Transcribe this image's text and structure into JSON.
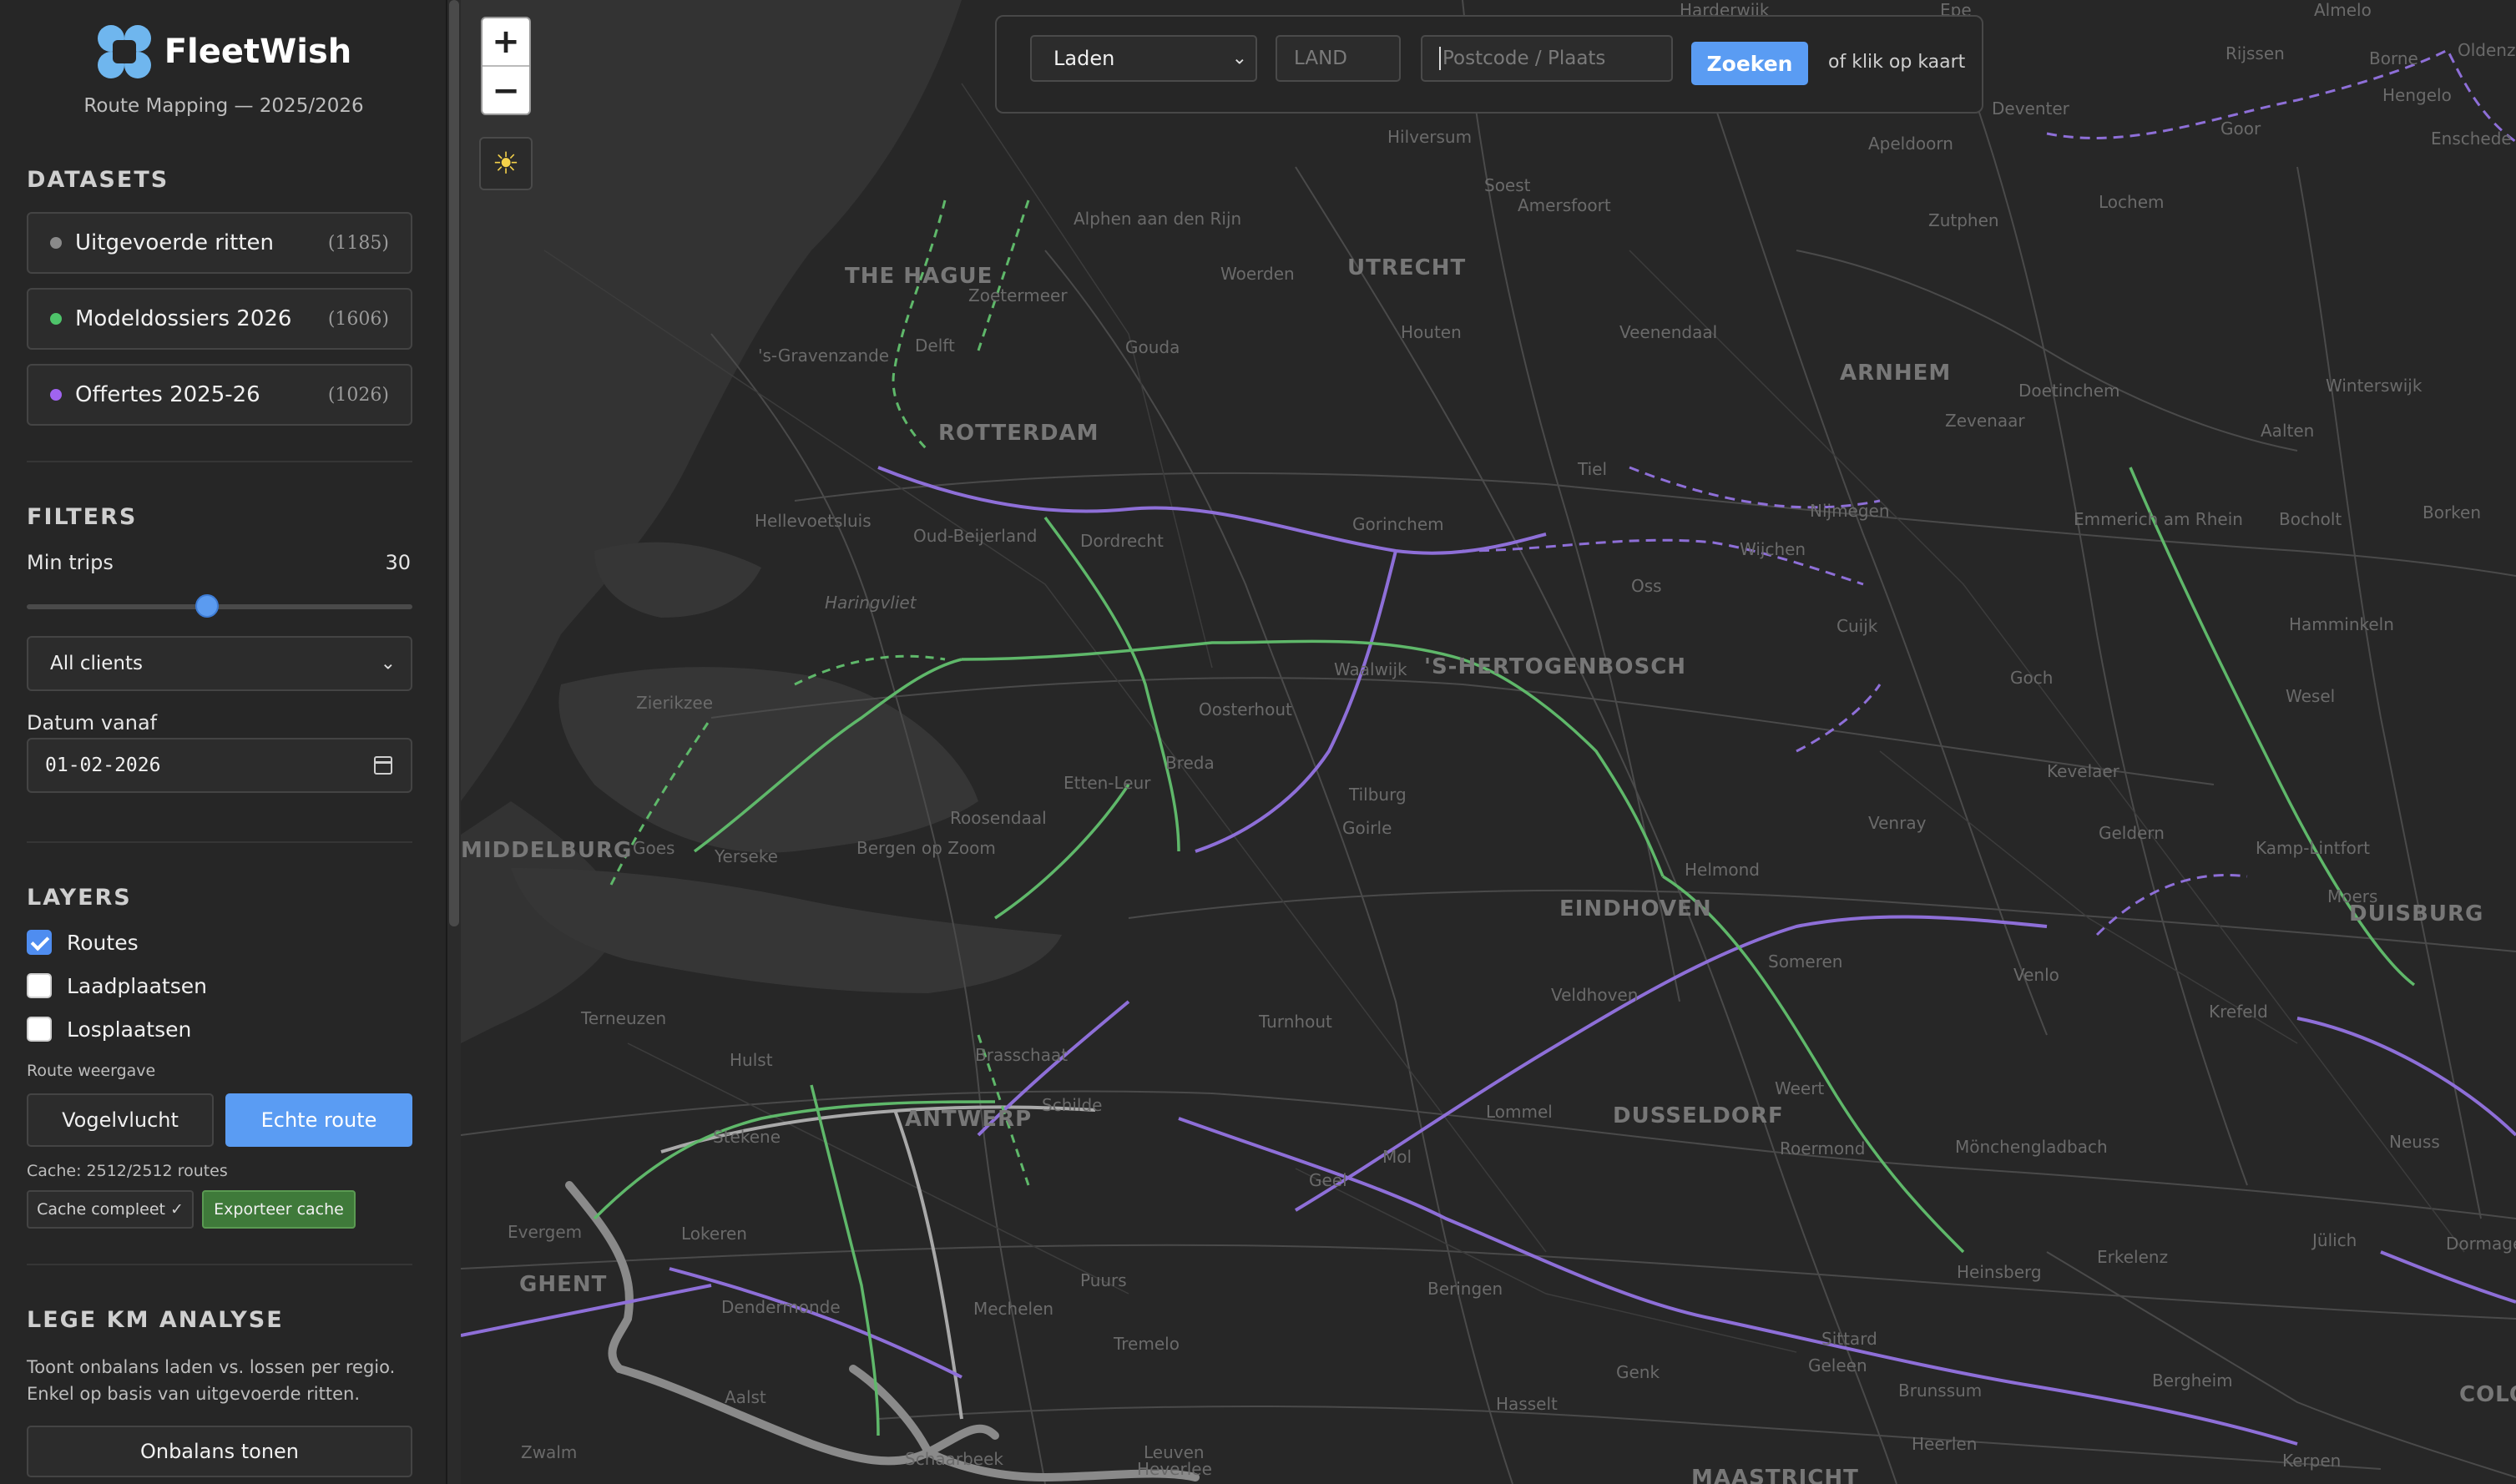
{
  "brand": {
    "title": "FleetWish",
    "subtitle": "Route Mapping — 2025/2026"
  },
  "datasets": {
    "title": "DATASETS",
    "items": [
      {
        "label": "Uitgevoerde ritten",
        "count": "(1185)",
        "color": "#8a8a8a"
      },
      {
        "label": "Modeldossiers 2026",
        "count": "(1606)",
        "color": "#4ec46a"
      },
      {
        "label": "Offertes 2025-26",
        "count": "(1026)",
        "color": "#a064f0"
      }
    ]
  },
  "filters": {
    "title": "FILTERS",
    "min_trips_label": "Min trips",
    "min_trips_value": "30",
    "client_select": "All clients",
    "date_label": "Datum vanaf",
    "date_value": "01-02-2026"
  },
  "layers": {
    "title": "LAYERS",
    "items": [
      {
        "label": "Routes",
        "checked": true
      },
      {
        "label": "Laadplaatsen",
        "checked": false
      },
      {
        "label": "Losplaatsen",
        "checked": false
      }
    ],
    "route_view_label": "Route weergave",
    "btn_straight": "Vogelvlucht",
    "btn_real": "Echte route",
    "cache_text": "Cache: 2512/2512 routes",
    "cache_complete": "Cache compleet ✓",
    "export_cache": "Exporteer cache"
  },
  "empty_km": {
    "title": "LEGE KM ANALYSE",
    "desc_line1": "Toont onbalans laden vs. lossen per regio.",
    "desc_line2": "Enkel op basis van uitgevoerde ritten.",
    "button": "Onbalans tonen"
  },
  "map": {
    "zoom_in": "+",
    "zoom_out": "−",
    "theme_icon": "☀",
    "search": {
      "mode": "Laden",
      "country_placeholder": "LAND",
      "place_placeholder": "Postcode / Plaats",
      "button": "Zoeken",
      "hint": "of klik op kaart"
    },
    "labels": [
      {
        "text": "THE HAGUE",
        "big": true
      },
      {
        "text": "Zoetermeer"
      },
      {
        "text": "'s-Gravenzande"
      },
      {
        "text": "Delft"
      },
      {
        "text": "ROTTERDAM",
        "big": true
      },
      {
        "text": "Alphen aan den Rijn"
      },
      {
        "text": "Gouda"
      },
      {
        "text": "Woerden"
      },
      {
        "text": "UTRECHT",
        "big": true
      },
      {
        "text": "Houten"
      },
      {
        "text": "Hilversum"
      },
      {
        "text": "Soest"
      },
      {
        "text": "Amersfoort"
      },
      {
        "text": "Veenendaal"
      },
      {
        "text": "Apeldoorn"
      },
      {
        "text": "Deventer"
      },
      {
        "text": "Zutphen"
      },
      {
        "text": "Lochem"
      },
      {
        "text": "Rijssen"
      },
      {
        "text": "Borne"
      },
      {
        "text": "Hengelo"
      },
      {
        "text": "Enschede"
      },
      {
        "text": "Goor"
      },
      {
        "text": "ARNHEM",
        "big": true
      },
      {
        "text": "Doetinchem"
      },
      {
        "text": "Zevenaar"
      },
      {
        "text": "Winterswijk"
      },
      {
        "text": "Aalten"
      },
      {
        "text": "Bocholt"
      },
      {
        "text": "Borken"
      },
      {
        "text": "Emmerich am Rhein"
      },
      {
        "text": "Nijmegen"
      },
      {
        "text": "Wijchen"
      },
      {
        "text": "Tiel"
      },
      {
        "text": "Gorinchem"
      },
      {
        "text": "Hellevoetsluis"
      },
      {
        "text": "Oud-Beijerland"
      },
      {
        "text": "Dordrecht"
      },
      {
        "text": "Haringvliet"
      },
      {
        "text": "Oss"
      },
      {
        "text": "Cuijk"
      },
      {
        "text": "Hamminkeln"
      },
      {
        "text": "Wesel"
      },
      {
        "text": "Goch"
      },
      {
        "text": "Kevelaer"
      },
      {
        "text": "Geldern"
      },
      {
        "text": "Kamp-Lintfort"
      },
      {
        "text": "Moers"
      },
      {
        "text": "DUISBURG",
        "big": true
      },
      {
        "text": "Zierikzee"
      },
      {
        "text": "Waalwijk"
      },
      {
        "text": "'S-HERTOGENBOSCH",
        "big": true
      },
      {
        "text": "Oosterhout"
      },
      {
        "text": "Breda"
      },
      {
        "text": "Tilburg"
      },
      {
        "text": "Goirle"
      },
      {
        "text": "Etten-Leur"
      },
      {
        "text": "Roosendaal"
      },
      {
        "text": "Bergen op Zoom"
      },
      {
        "text": "Yerseke"
      },
      {
        "text": "Goes"
      },
      {
        "text": "MIDDELBURG",
        "big": true
      },
      {
        "text": "Venray"
      },
      {
        "text": "Helmond"
      },
      {
        "text": "EINDHOVEN",
        "big": true
      },
      {
        "text": "Someren"
      },
      {
        "text": "Veldhoven"
      },
      {
        "text": "Venlo"
      },
      {
        "text": "Krefeld"
      },
      {
        "text": "Terneuzen"
      },
      {
        "text": "Hulst"
      },
      {
        "text": "Brasschaat"
      },
      {
        "text": "Turnhout"
      },
      {
        "text": "Schilde"
      },
      {
        "text": "ANTWERP",
        "big": true
      },
      {
        "text": "Stekene"
      },
      {
        "text": "Lokeren"
      },
      {
        "text": "Evergem"
      },
      {
        "text": "GHENT",
        "big": true
      },
      {
        "text": "Dendermonde"
      },
      {
        "text": "Mechelen"
      },
      {
        "text": "Puurs"
      },
      {
        "text": "Tremelo"
      },
      {
        "text": "Aalst"
      },
      {
        "text": "Zwalm"
      },
      {
        "text": "Schaarbeek"
      },
      {
        "text": "Leuven"
      },
      {
        "text": "Heverlee"
      },
      {
        "text": "Lommel"
      },
      {
        "text": "Mol"
      },
      {
        "text": "Geel"
      },
      {
        "text": "Weert"
      },
      {
        "text": "Roermond"
      },
      {
        "text": "Mönchengladbach"
      },
      {
        "text": "DUSSELDORF",
        "big": true
      },
      {
        "text": "Neuss"
      },
      {
        "text": "Dormagen"
      },
      {
        "text": "Erkelenz"
      },
      {
        "text": "Heinsberg"
      },
      {
        "text": "Jülich"
      },
      {
        "text": "Beringen"
      },
      {
        "text": "Hasselt"
      },
      {
        "text": "Genk"
      },
      {
        "text": "Sittard"
      },
      {
        "text": "Geleen"
      },
      {
        "text": "Brunssum"
      },
      {
        "text": "Heerlen"
      },
      {
        "text": "Bergheim"
      },
      {
        "text": "Kerpen"
      },
      {
        "text": "MAASTRICHT",
        "big": true
      },
      {
        "text": "COLOGNE",
        "big": true
      },
      {
        "text": "Oldenzaal"
      },
      {
        "text": "Almelo"
      },
      {
        "text": "Epe"
      },
      {
        "text": "Harderwijk"
      }
    ]
  }
}
